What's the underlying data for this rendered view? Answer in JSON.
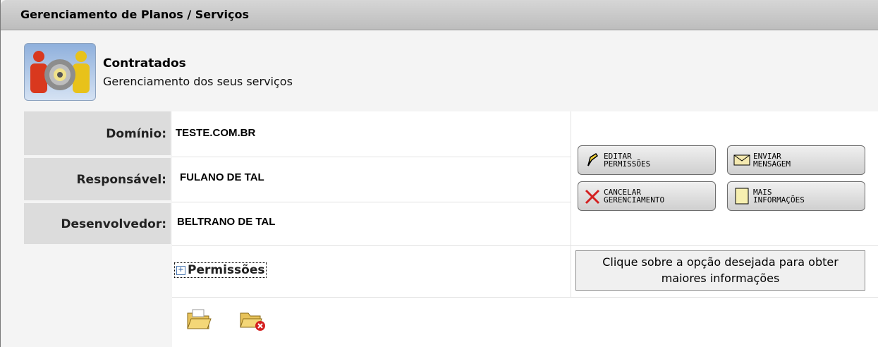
{
  "window": {
    "title": "Gerenciamento de Planos / Serviços"
  },
  "header": {
    "title": "Contratados",
    "subtitle": "Gerenciamento dos seus serviços",
    "icon": "people-gear-icon"
  },
  "fields": [
    {
      "label": "Domínio:",
      "value": "TESTE.COM.BR"
    },
    {
      "label": "Responsável:",
      "value": "FULANO DE TAL"
    },
    {
      "label": "Desenvolvedor:",
      "value": "BELTRANO DE TAL"
    }
  ],
  "buttons": {
    "editar": {
      "line1": "EDITAR",
      "line2": "PERMISSÕES",
      "icon": "pencil-icon"
    },
    "enviar": {
      "line1": "ENVIAR",
      "line2": "MENSAGEM",
      "icon": "envelope-icon"
    },
    "cancelar": {
      "line1": "CANCELAR",
      "line2": "GERENCIAMENTO",
      "icon": "x-icon"
    },
    "mais": {
      "line1": "MAIS",
      "line2": "INFORMAÇÕES",
      "icon": "note-icon"
    }
  },
  "permissions": {
    "label": "Permissões",
    "expand_symbol": "+"
  },
  "info_box": {
    "line1": "Clique sobre a opção desejada para obter",
    "line2": "maiores informações"
  },
  "folder_icons": [
    "folder-open-icon",
    "folder-delete-icon"
  ],
  "colors": {
    "titlebar": "#c8c8c8",
    "label_bg": "#dcdcdc",
    "panel_bg": "#f4f4f4",
    "accent_red": "#d42020"
  }
}
